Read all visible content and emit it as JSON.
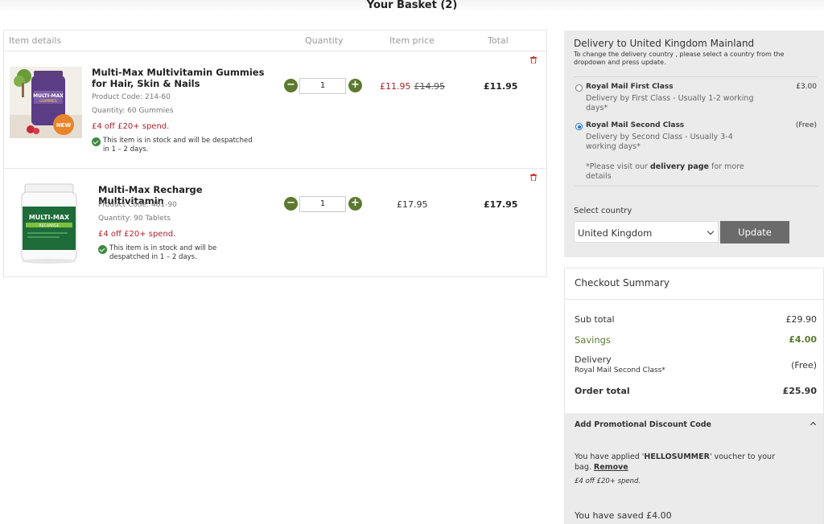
{
  "page": {
    "title": "Your Basket (2)"
  },
  "table": {
    "headers": {
      "item": "Item details",
      "quantity": "Quantity",
      "price": "Item price",
      "total": "Total"
    }
  },
  "items": [
    {
      "name": "Multi-Max Multivitamin Gummies for Hair, Skin & Nails",
      "code": "Product Code: 214-60",
      "quantity_text": "Quantity: 60 Gummies",
      "promo": "£4 off £20+ spend.",
      "stock": "This item is in stock and will be despatched in 1 – 2 days.",
      "qty": "1",
      "price": "£11.95",
      "was_price": "£14.95",
      "total": "£11.95",
      "image_badge": "NEW",
      "image_brand": "MULTI-MAX",
      "image_sub": "GUMMIES"
    },
    {
      "name": "Multi-Max Recharge Multivitamin",
      "code": "Product Code: 481-90",
      "quantity_text": "Quantity: 90 Tablets",
      "promo": "£4 off £20+ spend.",
      "stock": "This item is in stock and will be despatched in 1 – 2 days.",
      "qty": "1",
      "price": "£17.95",
      "total": "£17.95",
      "image_brand": "MULTI-MAX",
      "image_sub": "RECHARGE"
    }
  ],
  "delivery": {
    "title": "Delivery to United Kingdom Mainland",
    "note": "To change the delivery country , please select a country from the dropdown and press update.",
    "options": [
      {
        "name": "Royal Mail First Class",
        "price": "£3.00",
        "desc": "Delivery by First Class - Usually 1-2 working days*",
        "selected": false
      },
      {
        "name": "Royal Mail Second Class",
        "price": "(Free)",
        "desc": "Delivery by Second Class - Usually 3-4 working days*",
        "selected": true
      }
    ],
    "link_pre": "*Please visit our ",
    "link_text": "delivery page",
    "link_post": " for more details",
    "select_label": "Select country",
    "country": "United Kingdom",
    "update_label": "Update"
  },
  "summary": {
    "title": "Checkout Summary",
    "subtotal_label": "Sub total",
    "subtotal": "£29.90",
    "savings_label": "Savings",
    "savings": "£4.00",
    "delivery_label": "Delivery",
    "delivery_method": "Royal Mail Second Class*",
    "delivery_value": "(Free)",
    "order_total_label": "Order total",
    "order_total": "£25.90"
  },
  "promo": {
    "title": "Add Promotional Discount Code",
    "applied_pre": "You have applied '",
    "code": "HELLOSUMMER",
    "applied_post": "' voucher to your bag. ",
    "remove_label": "Remove",
    "promo_desc": "£4 off £20+ spend.",
    "saved_text": "You have saved £4.00"
  },
  "colors": {
    "accent_green": "#5c7a2f",
    "sale_red": "#b0212b",
    "panel_grey": "#ebebeb",
    "button_grey": "#6b6b6b"
  }
}
